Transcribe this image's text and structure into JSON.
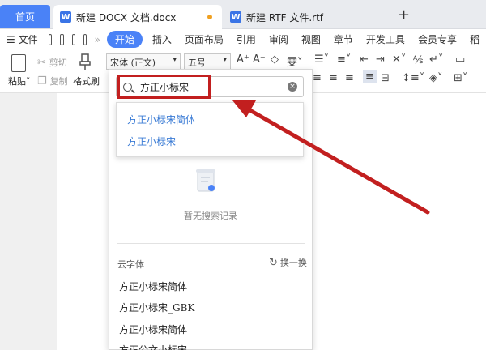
{
  "tabs": {
    "home": "首页",
    "active_doc": "新建 DOCX 文档.docx",
    "inactive_doc": "新建 RTF 文件.rtf",
    "new_tab": "+"
  },
  "menu": {
    "file": "文件",
    "items": [
      "开始",
      "插入",
      "页面布局",
      "引用",
      "审阅",
      "视图",
      "章节",
      "开发工具",
      "会员专享",
      "稻"
    ]
  },
  "ribbon": {
    "paste": "粘贴",
    "cut": "剪切",
    "copy": "复制",
    "format_painter": "格式刷",
    "font_name": "宋体 (正文)",
    "font_size": "五号"
  },
  "font_dropdown": {
    "search_value": "方正小标宋",
    "suggestions": [
      "方正小标宋简体",
      "方正小标宋"
    ],
    "empty_text": "暂无搜索记录",
    "cloud_title": "云字体",
    "refresh_label": "换一换",
    "cloud_fonts": [
      "方正小标宋简体",
      "方正小标宋_GBK",
      "方正小标宋简体",
      "方正公文小标宋"
    ]
  },
  "colors": {
    "accent": "#4a82f7",
    "annotation": "#c21f1f",
    "suggestion_text": "#3a7bd5"
  }
}
